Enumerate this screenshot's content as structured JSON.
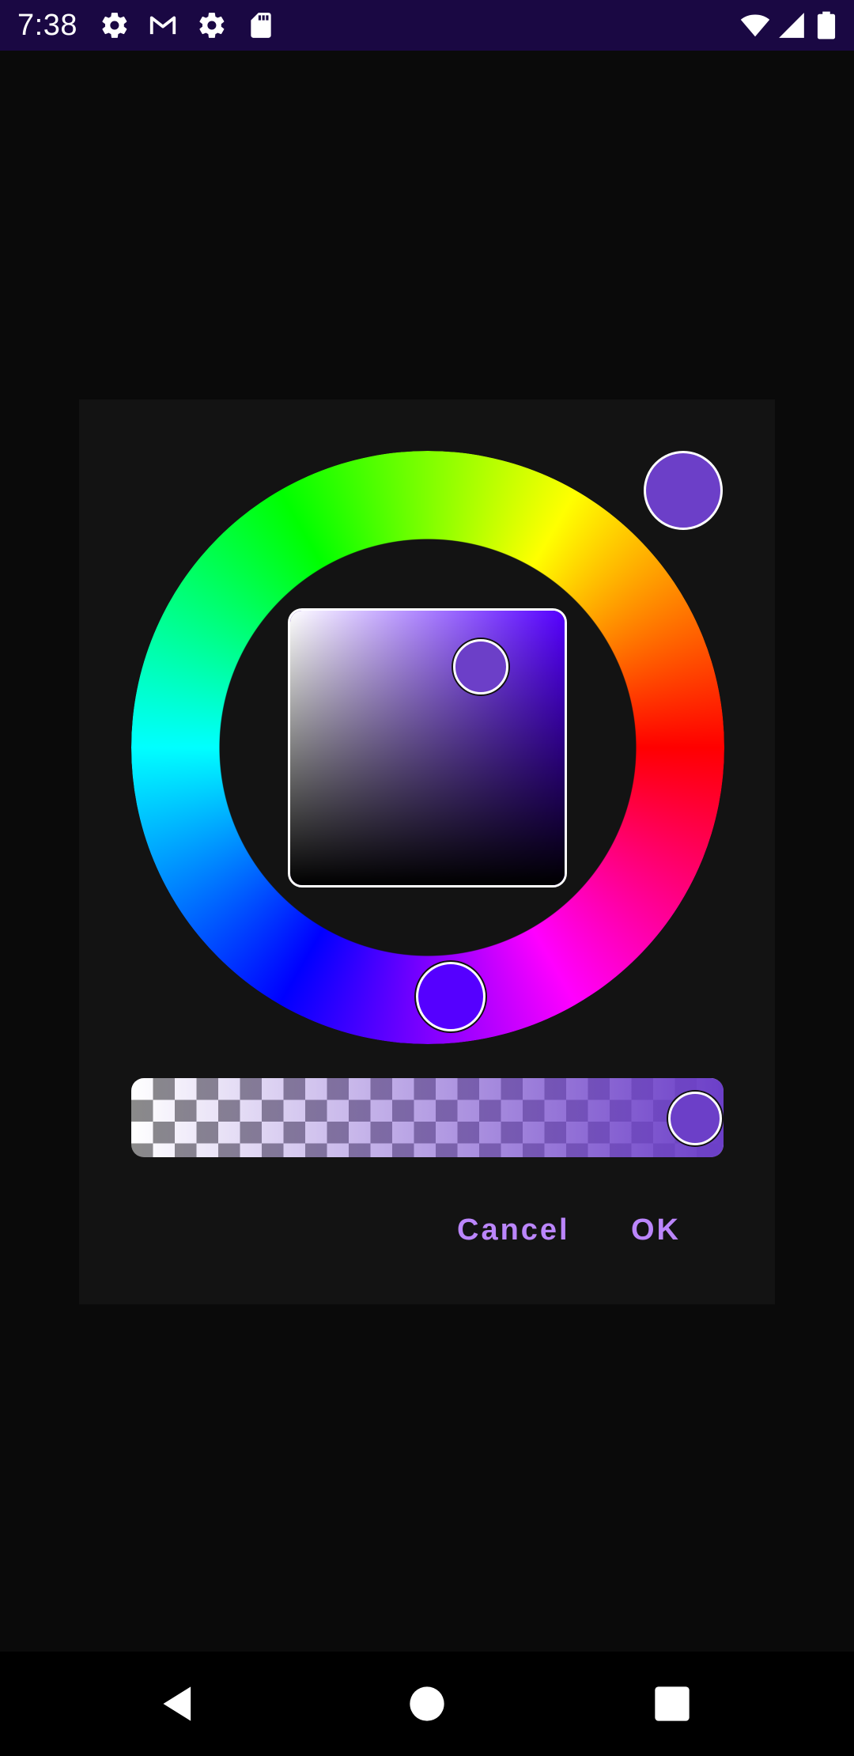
{
  "status_bar": {
    "time": "7:38",
    "left_icons": [
      "settings-gear-icon",
      "gmail-icon",
      "settings-gear-icon",
      "sd-card-icon"
    ],
    "right_icons": [
      "wifi-icon",
      "cellular-signal-icon",
      "battery-icon"
    ]
  },
  "color_picker": {
    "selected_color": "#6c3fc8",
    "hue_color": "#5500ff",
    "buttons": {
      "cancel": "Cancel",
      "ok": "OK"
    }
  },
  "colors": {
    "status_bar_bg": "#1a0843",
    "dialog_bg": "#131313",
    "button_text": "#bb86fc"
  },
  "nav_bar": {
    "items": [
      "back-icon",
      "home-icon",
      "recents-icon"
    ]
  }
}
